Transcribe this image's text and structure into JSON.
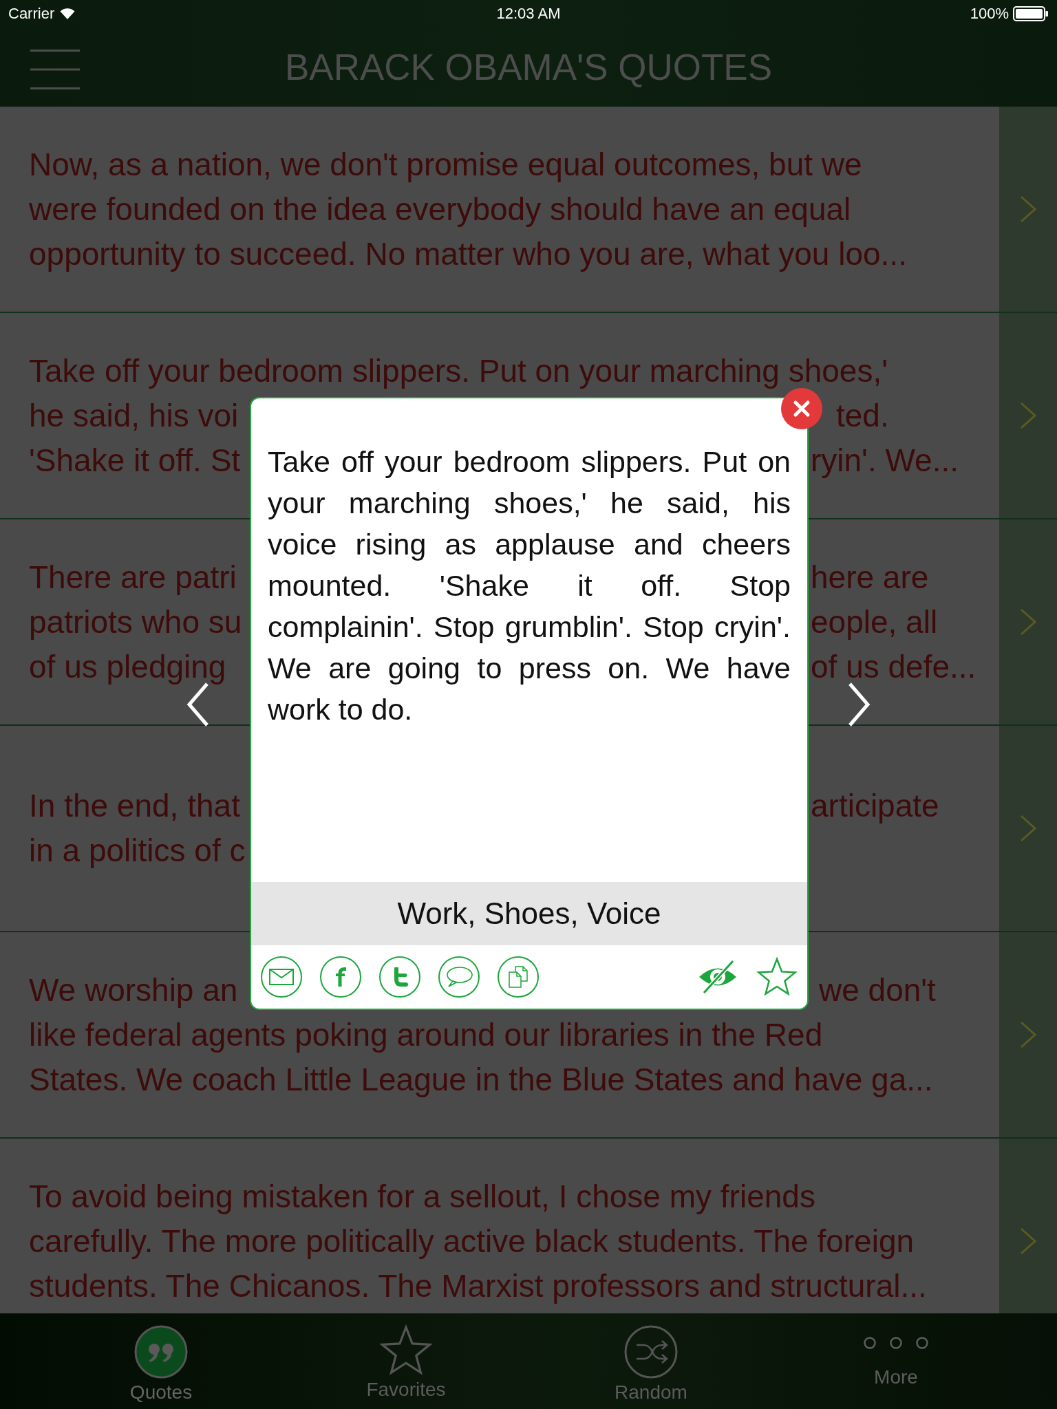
{
  "status_bar": {
    "carrier": "Carrier",
    "time": "12:03 AM",
    "battery": "100%"
  },
  "header": {
    "title": "BARACK OBAMA'S QUOTES"
  },
  "quotes": [
    {
      "kind": "full",
      "lines": [
        "Now, as a nation, we don't promise equal outcomes, but we",
        "were founded on the idea everybody should have an equal",
        "opportunity to succeed. No matter who you are, what you loo..."
      ]
    },
    {
      "kind": "covered",
      "lines": [
        {
          "left": "Take off your bedroom slippers. Put on your marching shoes,'"
        },
        {
          "left": "he said, his voi",
          "right": "ted."
        },
        {
          "left": "'Shake it off. St",
          "right": "ryin'. We..."
        }
      ]
    },
    {
      "kind": "covered",
      "lines": [
        {
          "left": "There are patri",
          "right": "here are"
        },
        {
          "left": "patriots who su",
          "right": "eople, all"
        },
        {
          "left": "of us pledging",
          "right": "of us defe..."
        }
      ]
    },
    {
      "kind": "covered",
      "lines": [
        {
          "left": "In the end, that",
          "right": "articipate"
        },
        {
          "left": "in a politics of c"
        }
      ]
    },
    {
      "kind": "covered",
      "lines": [
        {
          "left": "We worship an",
          "right": "we don't"
        },
        {
          "left": "like federal agents poking around our libraries in the Red"
        },
        {
          "left": "States. We coach Little League in the Blue States and have ga..."
        }
      ]
    },
    {
      "kind": "full",
      "lines": [
        "To avoid being mistaken for a sellout, I chose my friends",
        "carefully. The more politically active black students. The foreign",
        "students. The Chicanos. The Marxist professors and structural..."
      ]
    }
  ],
  "popup": {
    "quote": "Take off your bedroom slippers. Put on your marching shoes,' he said, his voice rising as applause and cheers mounted. 'Shake it off. Stop complainin'. Stop grumblin'. Stop cryin'. We are going to press on. We have work to do.",
    "tags": "Work, Shoes, Voice",
    "share_buttons": [
      {
        "kind": "email"
      },
      {
        "kind": "facebook"
      },
      {
        "kind": "twitter"
      },
      {
        "kind": "message"
      },
      {
        "kind": "copy"
      }
    ],
    "favorited": false
  },
  "tab_bar": [
    {
      "label": "Quotes",
      "kind": "quotes",
      "selected": true
    },
    {
      "label": "Favorites",
      "kind": "favorites",
      "selected": false
    },
    {
      "label": "Random",
      "kind": "random",
      "selected": false
    },
    {
      "label": "More",
      "kind": "more",
      "selected": false
    }
  ]
}
